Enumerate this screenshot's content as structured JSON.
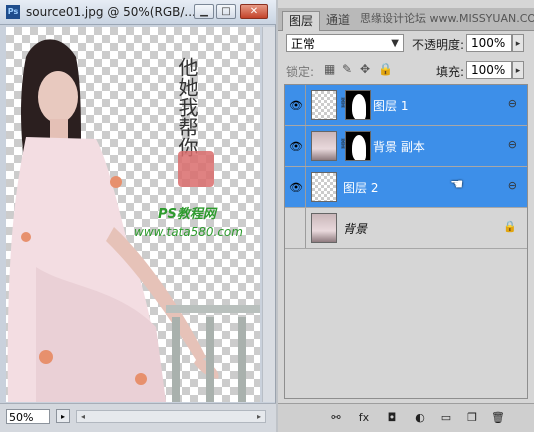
{
  "document_window": {
    "app_icon": "Ps",
    "title": "source01.jpg @ 50%(RGB/...",
    "zoom": "50%",
    "canvas_text": {
      "calligraphy": "他她我帮你",
      "ps_text": "PS教程网",
      "url": "www.tata580.com"
    }
  },
  "layers_panel": {
    "tabs": [
      "图层",
      "通道"
    ],
    "watermark": "思缘设计论坛 www.MISSYUAN.COM",
    "blend_mode": "正常",
    "opacity_label": "不透明度:",
    "opacity_value": "100%",
    "lock_label": "锁定:",
    "fill_label": "填充:",
    "fill_value": "100%",
    "layers": [
      {
        "name": "图层 1",
        "selected": true,
        "visible": true,
        "has_mask": true,
        "thumb": "transparent"
      },
      {
        "name": "背景 副本",
        "selected": true,
        "visible": true,
        "has_mask": true,
        "thumb": "photo"
      },
      {
        "name": "图层 2",
        "selected": true,
        "visible": true,
        "has_mask": false,
        "thumb": "transparent"
      },
      {
        "name": "背景",
        "selected": false,
        "visible": false,
        "has_mask": false,
        "thumb": "photo",
        "locked": true
      }
    ],
    "bottom_icons": [
      "link-icon",
      "fx-icon",
      "mask-icon",
      "adjustment-icon",
      "folder-icon",
      "new-layer-icon",
      "trash-icon"
    ]
  },
  "colors": {
    "selection": "#3d8fe9",
    "text_green": "#2e9b2e"
  }
}
